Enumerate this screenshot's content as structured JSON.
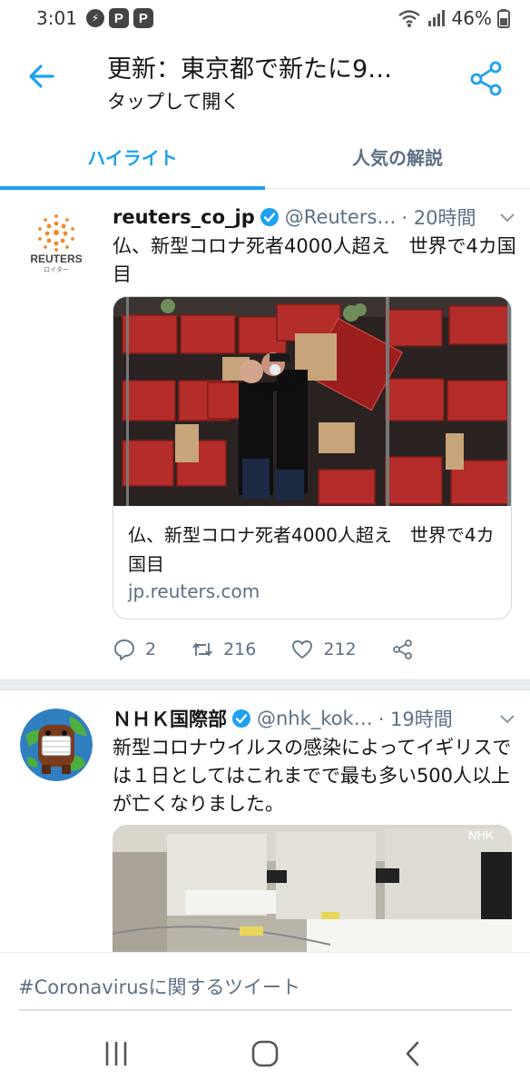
{
  "status_bar": {
    "time": "3:01",
    "battery": "46%"
  },
  "header": {
    "title": "更新：東京都で新たに9…",
    "subtitle": "タップして開く"
  },
  "tabs": [
    {
      "label": "ハイライト",
      "active": true
    },
    {
      "label": "人気の解説",
      "active": false
    }
  ],
  "tweets": [
    {
      "avatar_text": "REUTERS",
      "avatar_subtext": "ロイター",
      "name": "reuters_co_jp",
      "handle": "@Reuters…",
      "time": "· 20時間",
      "text": "仏、新型コロナ死者4000人超え　世界で4カ国目",
      "card": {
        "title": "仏、新型コロナ死者4000人超え　世界で4カ国目",
        "domain": "jp.reuters.com"
      },
      "stats": {
        "replies": "2",
        "retweets": "216",
        "likes": "212"
      }
    },
    {
      "name": "ＮＨＫ国際部",
      "handle": "@nhk_kok…",
      "time": "· 19時間",
      "text": "新型コロナウイルスの感染によってイギリスでは１日としてはこれまでで最も多い500人以上が亡くなりました。",
      "photo_watermark": "NHK"
    }
  ],
  "bottom_bar": {
    "label": "#Coronavirusに関するツイート"
  },
  "colors": {
    "accent": "#1da1f2",
    "muted": "#5b7083",
    "reuters_orange": "#f08a24"
  },
  "icons": [
    "back-arrow-icon",
    "share-icon",
    "verified-badge-icon",
    "chevron-down-icon",
    "reply-icon",
    "retweet-icon",
    "like-icon",
    "recents-icon",
    "home-icon",
    "nav-back-icon"
  ]
}
